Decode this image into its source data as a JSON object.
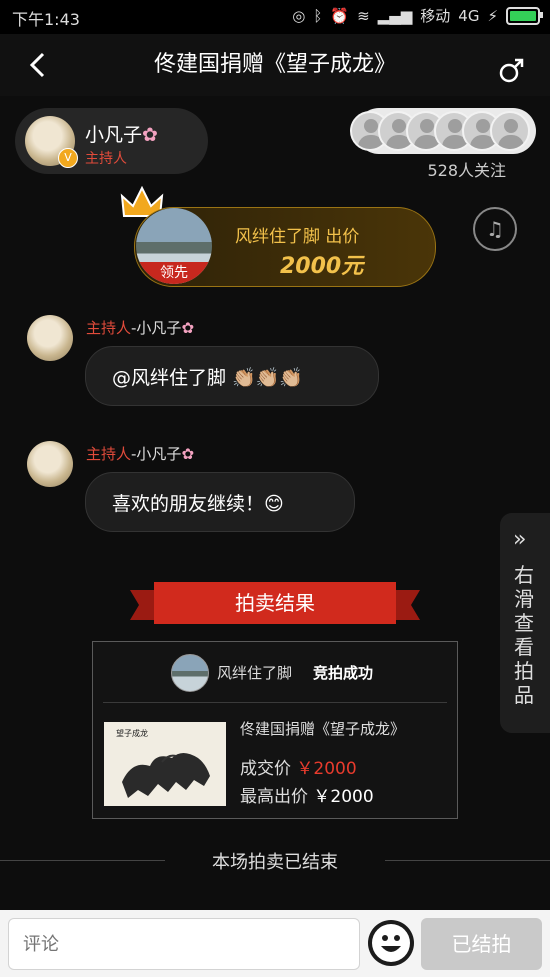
{
  "status_bar": {
    "time": "下午1:43",
    "carrier": "移动",
    "network": "4G",
    "icons": [
      "alarm-icon",
      "bluetooth-icon",
      "clock-icon",
      "wifi-icon",
      "signal-icon",
      "battery-icon"
    ]
  },
  "nav": {
    "title": "佟建国捐赠《望子成龙》",
    "back_icon": "back-arrow-icon",
    "share_icon": "share-icon"
  },
  "host": {
    "name": "小凡子",
    "role": "主持人",
    "badge": "V"
  },
  "followers": {
    "count_label": "528人关注"
  },
  "leading_bid": {
    "tag": "领先",
    "bidder_text": "风绊住了脚 出价",
    "price": "2000元"
  },
  "messages": [
    {
      "role": "主持人",
      "name": "-小凡子",
      "text": "@风绊住了脚 👏🏼👏🏼👏🏼"
    },
    {
      "role": "主持人",
      "name": "-小凡子",
      "text": "喜欢的朋友继续！😊"
    }
  ],
  "result": {
    "banner": "拍卖结果",
    "winner": "风绊住了脚",
    "status": "竞拍成功",
    "item_title": "佟建国捐赠《望子成龙》",
    "deal_label": "成交价",
    "deal_value": "￥2000",
    "max_label": "最高出价",
    "max_value": "￥2000"
  },
  "ended_text": "本场拍卖已结束",
  "side_panel": {
    "text": "右滑查看拍品"
  },
  "bottom_bar": {
    "comment_placeholder": "评论",
    "ended_button": "已结拍"
  },
  "colors": {
    "accent_red": "#d12a1d",
    "gold": "#f2c14b",
    "host_role": "#e14b3b"
  }
}
